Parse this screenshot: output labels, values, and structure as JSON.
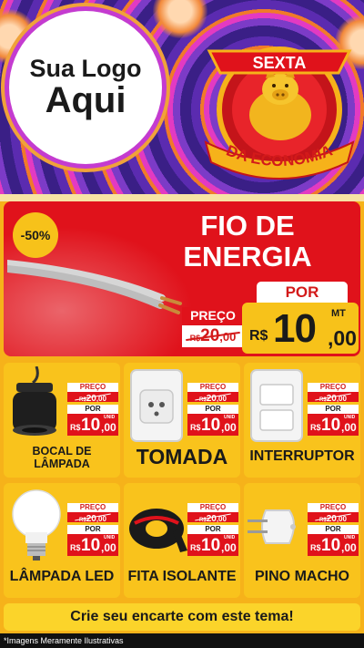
{
  "header": {
    "logo_line1": "Sua Logo",
    "logo_line2": "Aqui",
    "badge_top": "SEXTA",
    "badge_bottom": "DA ECONOMIA"
  },
  "hero": {
    "discount": "-50%",
    "title_line1": "FIO DE",
    "title_line2": "ENERGIA",
    "preco_label": "PREÇO",
    "old_currency": "R$",
    "old_int": "20",
    "old_cents": ",00",
    "por_label": "POR",
    "currency": "R$",
    "price_int": "10",
    "price_cents": ",00",
    "unit": "MT"
  },
  "products": [
    {
      "name": "BOCAL DE LÂMPADA",
      "preco_label": "PREÇO",
      "old_currency": "R$",
      "old_int": "20",
      "old_cents": ",00",
      "por_label": "POR",
      "currency": "R$",
      "price_int": "10",
      "price_cents": ",00",
      "unit": "UNID",
      "icon": "bulb-socket-icon"
    },
    {
      "name": "TOMADA",
      "preco_label": "PREÇO",
      "old_currency": "R$",
      "old_int": "20",
      "old_cents": ",00",
      "por_label": "POR",
      "currency": "R$",
      "price_int": "10",
      "price_cents": ",00",
      "unit": "UNID",
      "icon": "outlet-icon"
    },
    {
      "name": "INTERRUPTOR",
      "preco_label": "PREÇO",
      "old_currency": "R$",
      "old_int": "20",
      "old_cents": ",00",
      "por_label": "POR",
      "currency": "R$",
      "price_int": "10",
      "price_cents": ",00",
      "unit": "UNID",
      "icon": "switch-icon"
    },
    {
      "name": "LÂMPADA LED",
      "preco_label": "PREÇO",
      "old_currency": "R$",
      "old_int": "20",
      "old_cents": ",00",
      "por_label": "POR",
      "currency": "R$",
      "price_int": "10",
      "price_cents": ",00",
      "unit": "UNID",
      "icon": "led-bulb-icon"
    },
    {
      "name": "FITA ISOLANTE",
      "preco_label": "PREÇO",
      "old_currency": "R$",
      "old_int": "20",
      "old_cents": ",00",
      "por_label": "POR",
      "currency": "R$",
      "price_int": "10",
      "price_cents": ",00",
      "unit": "UNID",
      "icon": "tape-icon"
    },
    {
      "name": "PINO MACHO",
      "preco_label": "PREÇO",
      "old_currency": "R$",
      "old_int": "20",
      "old_cents": ",00",
      "por_label": "POR",
      "currency": "R$",
      "price_int": "10",
      "price_cents": ",00",
      "unit": "UNID",
      "icon": "plug-icon"
    }
  ],
  "cta": "Crie seu encarte com este tema!",
  "footer": "*Imagens Meramente Ilustrativas",
  "colors": {
    "red": "#e0121b",
    "yellow": "#f9c31c",
    "purple": "#7c3bc7"
  }
}
